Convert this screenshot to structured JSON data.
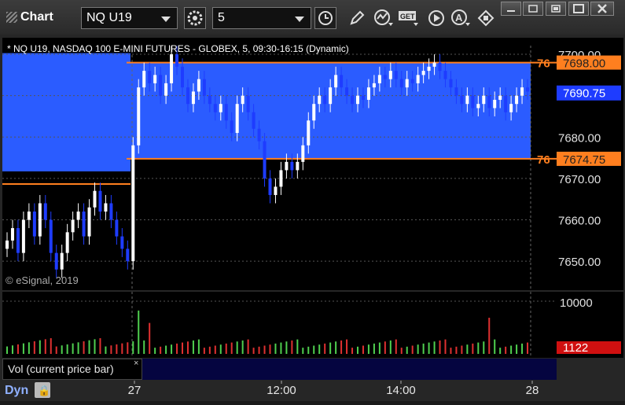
{
  "toolbar": {
    "app_title": "Chart",
    "symbol": "NQ U19",
    "interval": "5",
    "window_controls": [
      "minimize-icon",
      "restore-icon",
      "maximize-icon",
      "close-icon"
    ]
  },
  "chart": {
    "header": "* NQ U19, NASDAQ 100 E-MINI FUTURES - GLOBEX, 5, 09:30-16:15 (Dynamic)",
    "copyright": "© eSignal, 2019",
    "price_labels": [
      "7700.00",
      "7690.75",
      "7680.00",
      "7670.00",
      "7660.00",
      "7650.00"
    ],
    "upper_line": "7698.00",
    "lower_line": "7674.75",
    "current_price": "7690.75",
    "line_tag": "76"
  },
  "volume": {
    "label": "Vol (current price bar)",
    "close": "×",
    "axis_label": "10000",
    "current": "1122"
  },
  "time_axis": {
    "labels": [
      "27",
      "12:00",
      "14:00",
      "28"
    ],
    "dyn": "Dyn"
  },
  "colors": {
    "zone": "#2b5cff",
    "line": "#ff7f1f",
    "up_candle": "#ffffff",
    "down_candle": "#1e3cff",
    "vol_up": "#4fd04f",
    "vol_down": "#e03030"
  },
  "chart_data": {
    "type": "candlestick",
    "ylim": [
      7643,
      7704
    ],
    "closes": [
      7655,
      7658,
      7652,
      7660,
      7662,
      7656,
      7664,
      7660,
      7652,
      7648,
      7652,
      7657,
      7660,
      7662,
      7656,
      7663,
      7667,
      7662,
      7664,
      7660,
      7656,
      7653,
      7650,
      7678,
      7692,
      7696,
      7693,
      7695,
      7690,
      7693,
      7700,
      7697,
      7692,
      7688,
      7691,
      7694,
      7690,
      7688,
      7686,
      7688,
      7684,
      7681,
      7688,
      7690,
      7686,
      7682,
      7679,
      7670,
      7666,
      7668,
      7672,
      7674,
      7672,
      7674,
      7678,
      7684,
      7688,
      7690,
      7688,
      7692,
      7695,
      7692,
      7690,
      7688,
      7690,
      7689,
      7692,
      7693,
      7695,
      7694,
      7696,
      7694,
      7692,
      7694,
      7693,
      7695,
      7696,
      7697,
      7698,
      7696,
      7694,
      7692,
      7690,
      7688,
      7690,
      7687,
      7688,
      7690,
      7687,
      7689,
      7690,
      7686,
      7688,
      7690,
      7692,
      7691
    ],
    "volume_ylim": [
      0,
      16000
    ]
  }
}
